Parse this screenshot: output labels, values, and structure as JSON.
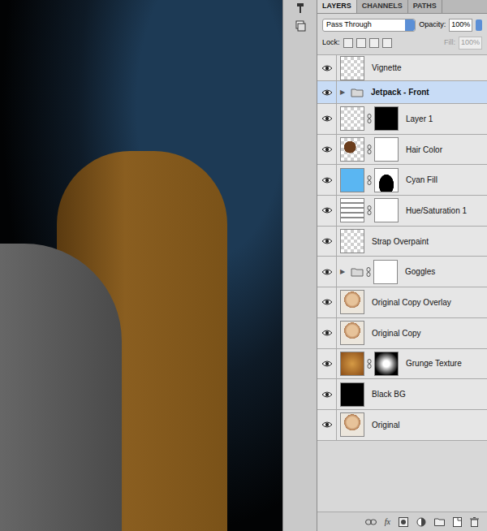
{
  "panel": {
    "tabs": [
      {
        "label": "LAYERS",
        "selected": true
      },
      {
        "label": "CHANNELS",
        "selected": false
      },
      {
        "label": "PATHS",
        "selected": false
      }
    ],
    "blend_mode": "Pass Through",
    "opacity_label": "Opacity:",
    "opacity": "100%",
    "lock_label": "Lock:",
    "fill_label": "Fill:",
    "fill": "100%",
    "fill_disabled": true
  },
  "layers": [
    {
      "name": "Vignette",
      "visible": true,
      "selected": false,
      "kind": "layer",
      "thumb": "transparent",
      "mask": "none"
    },
    {
      "name": "Jetpack - Front",
      "visible": true,
      "selected": true,
      "kind": "group",
      "toggle": "▶",
      "expanded": false,
      "thumb": "folder",
      "mask": "none"
    },
    {
      "name": "Layer 1",
      "visible": true,
      "selected": false,
      "kind": "layer",
      "thumb": "transparent",
      "mask": "dark"
    },
    {
      "name": "Hair Color",
      "visible": true,
      "selected": false,
      "kind": "layer",
      "thumb": "hair",
      "mask": "light"
    },
    {
      "name": "Cyan Fill",
      "visible": true,
      "selected": false,
      "kind": "layer",
      "thumb": "fill",
      "mask": "silhouette"
    },
    {
      "name": "Hue/Saturation 1",
      "visible": true,
      "selected": false,
      "kind": "layer",
      "thumb": "adjustment",
      "mask": "light"
    },
    {
      "name": "Strap Overpaint",
      "visible": true,
      "selected": false,
      "kind": "layer",
      "thumb": "transparent",
      "mask": "none"
    },
    {
      "name": "Goggles",
      "visible": true,
      "selected": false,
      "kind": "group",
      "toggle": "▶",
      "expanded": false,
      "thumb": "folder",
      "mask": "light"
    },
    {
      "name": "Original Copy Overlay",
      "visible": true,
      "selected": false,
      "kind": "layer",
      "thumb": "photo",
      "mask": "none"
    },
    {
      "name": "Original Copy",
      "visible": true,
      "selected": false,
      "kind": "layer",
      "thumb": "photo",
      "mask": "none"
    },
    {
      "name": "Grunge Texture",
      "visible": true,
      "selected": false,
      "kind": "layer",
      "thumb": "texture",
      "mask": "radial"
    },
    {
      "name": "Black BG",
      "visible": true,
      "selected": false,
      "kind": "layer",
      "thumb": "black",
      "mask": "none"
    },
    {
      "name": "Original",
      "visible": true,
      "selected": false,
      "kind": "layer",
      "thumb": "photo",
      "mask": "none"
    }
  ],
  "bottom_bar": {
    "fx": "fx"
  }
}
